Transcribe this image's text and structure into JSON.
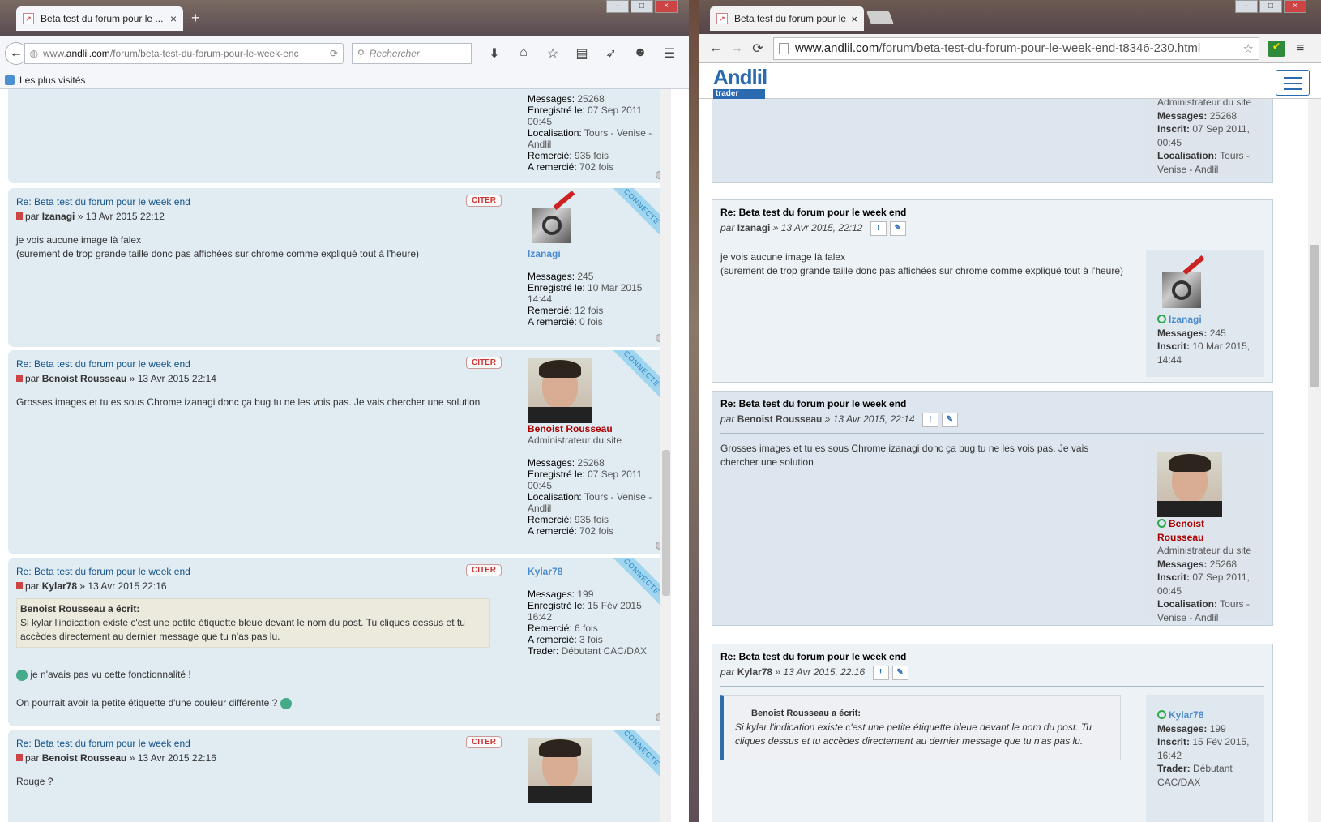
{
  "left_browser": {
    "tab_title": "Beta test du forum pour le ...",
    "url_domain": "www.",
    "url_host": "andlil.com",
    "url_path": "/forum/beta-test-du-forum-pour-le-week-enc",
    "search_placeholder": "Rechercher",
    "bookmark_label": "Les plus visités"
  },
  "right_browser": {
    "tab_title": "Beta test du forum pour le",
    "url_host": "www.andlil.com",
    "url_path": "/forum/beta-test-du-forum-pour-le-week-end-t8346-230.html",
    "logo_main": "Andlil",
    "logo_sub": "trader inside"
  },
  "left_posts": {
    "p0": {
      "l1": "Messages:",
      "v1": "25268",
      "l2": "Enregistré le:",
      "v2": "07 Sep 2011",
      "v2b": "00:45",
      "l3": "Localisation:",
      "v3": "Tours - Venise -",
      "v3b": "Andlil",
      "l4": "Remercié:",
      "v4": "935 fois",
      "l5": "A remercié:",
      "v5": "702 fois"
    },
    "p1": {
      "title": "Re: Beta test du forum pour le week end",
      "by": "par",
      "author": "Izanagi",
      "date": "» 13 Avr 2015 22:12",
      "body1": "je vois aucune image là falex",
      "body2": "(surement de trop grande taille donc pas affichées sur chrome comme expliqué tout à l'heure)",
      "citer": "CITER",
      "status": "CONNECTE",
      "uname": "Izanagi",
      "l1": "Messages:",
      "v1": "245",
      "l2": "Enregistré le:",
      "v2": "10 Mar 2015",
      "v2b": "14:44",
      "l4": "Remercié:",
      "v4": "12 fois",
      "l5": "A remercié:",
      "v5": "0 fois"
    },
    "p2": {
      "title": "Re: Beta test du forum pour le week end",
      "by": "par",
      "author": "Benoist Rousseau",
      "date": "» 13 Avr 2015 22:14",
      "body1": "Grosses images et tu es sous Chrome izanagi donc ça bug tu ne les vois pas. Je vais chercher une solution",
      "citer": "CITER",
      "status": "CONNECTE",
      "uname": "Benoist Rousseau",
      "rank": "Administrateur du site",
      "l1": "Messages:",
      "v1": "25268",
      "l2": "Enregistré le:",
      "v2": "07 Sep 2011",
      "v2b": "00:45",
      "l3": "Localisation:",
      "v3": "Tours - Venise -",
      "v3b": "Andlil",
      "l4": "Remercié:",
      "v4": "935 fois",
      "l5": "A remercié:",
      "v5": "702 fois"
    },
    "p3": {
      "title": "Re: Beta test du forum pour le week end",
      "by": "par",
      "author": "Kylar78",
      "date": "» 13 Avr 2015 22:16",
      "quote_author": "Benoist Rousseau a écrit:",
      "quote_text": "Si kylar l'indication existe c'est une petite étiquette bleue devant le nom du post. Tu cliques dessus et tu accèdes directement au dernier message que tu n'as pas lu.",
      "body1": "je n'avais pas vu cette fonctionnalité !",
      "body2": "On pourrait avoir la petite étiquette d'une couleur différente ?",
      "citer": "CITER",
      "status": "CONNECTE",
      "uname": "Kylar78",
      "l1": "Messages:",
      "v1": "199",
      "l2": "Enregistré le:",
      "v2": "15 Fév 2015",
      "v2b": "16:42",
      "l4": "Remercié:",
      "v4": "6 fois",
      "l5": "A remercié:",
      "v5": "3 fois",
      "l6": "Trader:",
      "v6": "Débutant CAC/DAX"
    },
    "p4": {
      "title": "Re: Beta test du forum pour le week end",
      "by": "par",
      "author": "Benoist Rousseau",
      "date": "» 13 Avr 2015 22:16",
      "body1": "Rouge ?",
      "citer": "CITER",
      "status": "CONNECTE"
    }
  },
  "right_posts": {
    "p0": {
      "rank": "Administrateur du site",
      "l1": "Messages:",
      "v1": "25268",
      "l2": "Inscrit:",
      "v2": "07 Sep 2011,",
      "v2b": "00:45",
      "l3": "Localisation:",
      "v3": "Tours -",
      "v3b": "Venise - Andlil"
    },
    "p1": {
      "title": "Re: Beta test du forum pour le week end",
      "by": "par",
      "author": "Izanagi",
      "date": "» 13 Avr 2015, 22:12",
      "body1": "je vois aucune image là falex",
      "body2": "(surement de trop grande taille donc pas affichées sur chrome comme expliqué tout à l'heure)",
      "uname": "Izanagi",
      "l1": "Messages:",
      "v1": "245",
      "l2": "Inscrit:",
      "v2": "10 Mar 2015,",
      "v2b": "14:44"
    },
    "p2": {
      "title": "Re: Beta test du forum pour le week end",
      "by": "par",
      "author": "Benoist Rousseau",
      "date": "» 13 Avr 2015, 22:14",
      "body1": "Grosses images et tu es sous Chrome izanagi donc ça bug tu ne les vois pas. Je vais chercher une solution",
      "uname": "Benoist Rousseau",
      "rank": "Administrateur du site",
      "l1": "Messages:",
      "v1": "25268",
      "l2": "Inscrit:",
      "v2": "07 Sep 2011,",
      "v2b": "00:45",
      "l3": "Localisation:",
      "v3": "Tours -",
      "v3b": "Venise - Andlil"
    },
    "p3": {
      "title": "Re: Beta test du forum pour le week end",
      "by": "par",
      "author": "Kylar78",
      "date": "» 13 Avr 2015, 22:16",
      "quote_author": "Benoist Rousseau a écrit:",
      "quote_text": "Si kylar l'indication existe c'est une petite étiquette bleue devant le nom du post. Tu cliques dessus et tu accèdes directement au dernier message que tu n'as pas lu.",
      "uname": "Kylar78",
      "l1": "Messages:",
      "v1": "199",
      "l2": "Inscrit:",
      "v2": "15 Fév 2015,",
      "v2b": "16:42",
      "l6": "Trader:",
      "v6": "Débutant",
      "v6b": "CAC/DAX"
    }
  }
}
